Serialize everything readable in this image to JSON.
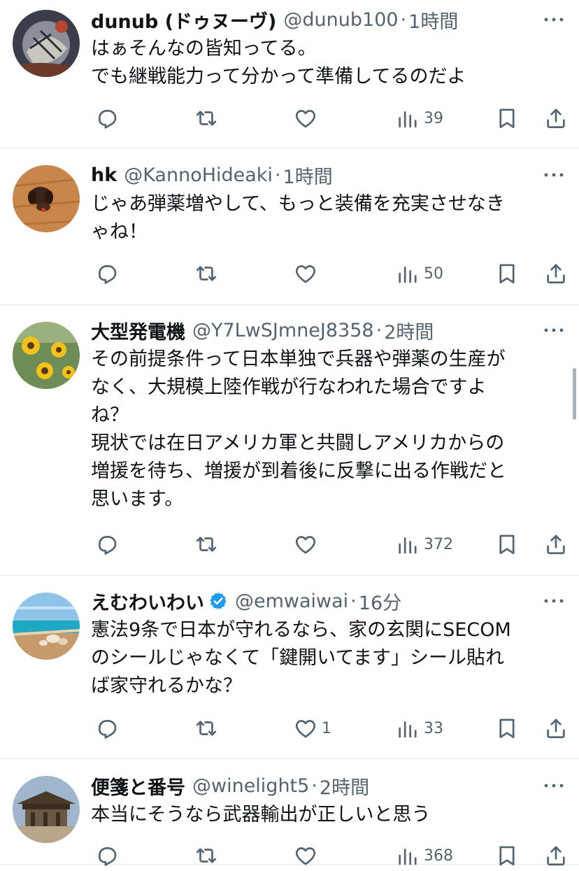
{
  "tweets": [
    {
      "name": "dunub (ドゥヌーヴ)",
      "handle": "@dunub100",
      "time": "1時間",
      "verified": false,
      "avatar_icon": "avatar-dark-illustration",
      "lines": [
        "はぁそんなの皆知ってる。",
        "でも継戦能力って分かって準備してるのだよ"
      ],
      "replies": "",
      "retweets": "",
      "likes": "",
      "views": "39"
    },
    {
      "name": "hk",
      "handle": "@KannoHideaki",
      "time": "1時間",
      "verified": false,
      "avatar_icon": "avatar-dog-on-wood",
      "lines": [
        "じゃあ弾薬増やして、もっと装備を充実させなき",
        "ゃね！"
      ],
      "replies": "",
      "retweets": "",
      "likes": "",
      "views": "50"
    },
    {
      "name": "大型発電機",
      "handle": "@Y7LwSJmneJ8358",
      "time": "2時間",
      "verified": false,
      "avatar_icon": "avatar-sunflowers",
      "lines": [
        "その前提条件って日本単独で兵器や弾薬の生産が",
        "なく、大規模上陸作戦が行なわれた場合ですよ",
        "ね？",
        "現状では在日アメリカ軍と共闘しアメリカからの",
        "増援を待ち、増援が到着後に反撃に出る作戦だと",
        "思います。"
      ],
      "replies": "",
      "retweets": "",
      "likes": "",
      "views": "372"
    },
    {
      "name": "えむわいわい",
      "handle": "@emwaiwai",
      "time": "16分",
      "verified": true,
      "avatar_icon": "avatar-beach",
      "lines": [
        "憲法9条で日本が守れるなら、家の玄関にSECOM",
        "のシールじゃなくて「鍵開いてます」シール貼れ",
        "ば家守れるかな？"
      ],
      "replies": "",
      "retweets": "",
      "likes": "1",
      "views": "33"
    },
    {
      "name": "便箋と番号",
      "handle": "@winelight5",
      "time": "2時間",
      "verified": false,
      "avatar_icon": "avatar-shrine",
      "lines": [
        "本当にそうなら武器輸出が正しいと思う"
      ],
      "replies": "",
      "retweets": "",
      "likes": "",
      "views": "368"
    }
  ],
  "ui": {
    "separator": "·",
    "colors": {
      "text": "#0f1419",
      "muted": "#536471",
      "divider": "#e6e9ec",
      "verified": "#1d9bf0"
    },
    "icons": [
      "reply-icon",
      "retweet-icon",
      "like-icon",
      "views-icon",
      "bookmark-icon",
      "share-icon",
      "more-icon",
      "verified-badge-icon"
    ]
  }
}
